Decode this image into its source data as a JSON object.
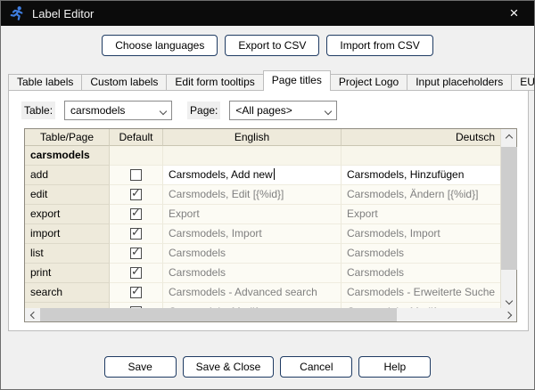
{
  "window": {
    "title": "Label Editor",
    "close_icon": "×"
  },
  "toolbar": {
    "buttons": [
      "Choose languages",
      "Export to CSV",
      "Import from CSV"
    ]
  },
  "tabs": [
    {
      "label": "Table labels",
      "active": false
    },
    {
      "label": "Custom labels",
      "active": false
    },
    {
      "label": "Edit form tooltips",
      "active": false
    },
    {
      "label": "Page titles",
      "active": true
    },
    {
      "label": "Project Logo",
      "active": false
    },
    {
      "label": "Input placeholders",
      "active": false
    },
    {
      "label": "EU cookie banner",
      "active": false
    }
  ],
  "filters": {
    "table_label": "Table:",
    "table_value": "carsmodels",
    "page_label": "Page:",
    "page_value": "<All pages>"
  },
  "grid": {
    "columns": [
      "Table/Page",
      "Default",
      "English",
      "Deutsch"
    ],
    "group_label": "carsmodels",
    "rows": [
      {
        "page": "add",
        "default_checked": false,
        "english": "Carsmodels, Add new",
        "deutsch": "Carsmodels, Hinzufügen",
        "editing": true
      },
      {
        "page": "edit",
        "default_checked": true,
        "english": "Carsmodels, Edit [{%id}]",
        "deutsch": "Carsmodels, Ändern [{%id}]",
        "editing": false
      },
      {
        "page": "export",
        "default_checked": true,
        "english": "Export",
        "deutsch": "Export",
        "editing": false
      },
      {
        "page": "import",
        "default_checked": true,
        "english": "Carsmodels, Import",
        "deutsch": "Carsmodels, Import",
        "editing": false
      },
      {
        "page": "list",
        "default_checked": true,
        "english": "Carsmodels",
        "deutsch": "Carsmodels",
        "editing": false
      },
      {
        "page": "print",
        "default_checked": true,
        "english": "Carsmodels",
        "deutsch": "Carsmodels",
        "editing": false
      },
      {
        "page": "search",
        "default_checked": true,
        "english": "Carsmodels - Advanced search",
        "deutsch": "Carsmodels - Erweiterte Suche",
        "editing": false
      }
    ],
    "partial_row": {
      "page": "",
      "english": "Carsmodels, Modify",
      "deutsch": "Carsmodels, Modify"
    }
  },
  "footer": {
    "buttons": [
      "Save",
      "Save & Close",
      "Cancel",
      "Help"
    ]
  },
  "colors": {
    "title_bar": "#0B0B0B",
    "icon_blue": "#3E7DE0",
    "header_beige": "#EEEADB",
    "button_border": "#1F3B63",
    "muted_text": "#7F7F7F"
  }
}
